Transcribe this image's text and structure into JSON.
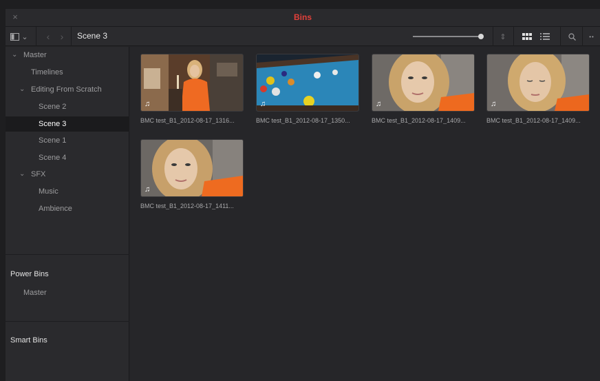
{
  "window": {
    "title": "Bins",
    "close_glyph": "×"
  },
  "toolbar": {
    "sidebar_toggle_icon": "sidebar-panel-icon",
    "dropdown_glyph": "⌄",
    "back_glyph": "‹",
    "forward_glyph": "›",
    "current_bin": "Scene 3",
    "zoom_level": 1.0,
    "sort_glyph": "⇕",
    "thumbnail_view_icon": "grid-icon",
    "list_view_icon": "list-icon",
    "search_glyph": "⌕",
    "more_glyph": "••"
  },
  "sidebar": {
    "master": {
      "chev": "⌄",
      "label": "Master"
    },
    "timelines": "Timelines",
    "editing": {
      "chev": "⌄",
      "label": "Editing From Scratch"
    },
    "scene2": "Scene 2",
    "scene3": "Scene 3",
    "scene1": "Scene 1",
    "scene4": "Scene 4",
    "sfx": {
      "chev": "⌄",
      "label": "SFX"
    },
    "music": "Music",
    "ambience": "Ambience",
    "power_bins": {
      "title": "Power Bins",
      "master": "Master"
    },
    "smart_bins": {
      "title": "Smart Bins"
    }
  },
  "clips": [
    {
      "label": "BMC test_B1_2012-08-17_1316...",
      "audio_glyph": "♫",
      "scene": "woman-pool-cue"
    },
    {
      "label": "BMC test_B1_2012-08-17_1350...",
      "audio_glyph": "♫",
      "scene": "pool-table"
    },
    {
      "label": "BMC test_B1_2012-08-17_1409...",
      "audio_glyph": "♫",
      "scene": "woman-portrait"
    },
    {
      "label": "BMC test_B1_2012-08-17_1409...",
      "audio_glyph": "♫",
      "scene": "woman-looking-down"
    },
    {
      "label": "BMC test_B1_2012-08-17_1411...",
      "audio_glyph": "♫",
      "scene": "woman-portrait"
    }
  ],
  "colors": {
    "title_accent": "#e2403a",
    "selected_bg": "#1b1b1d",
    "panel_bg": "#2a2a2d"
  }
}
